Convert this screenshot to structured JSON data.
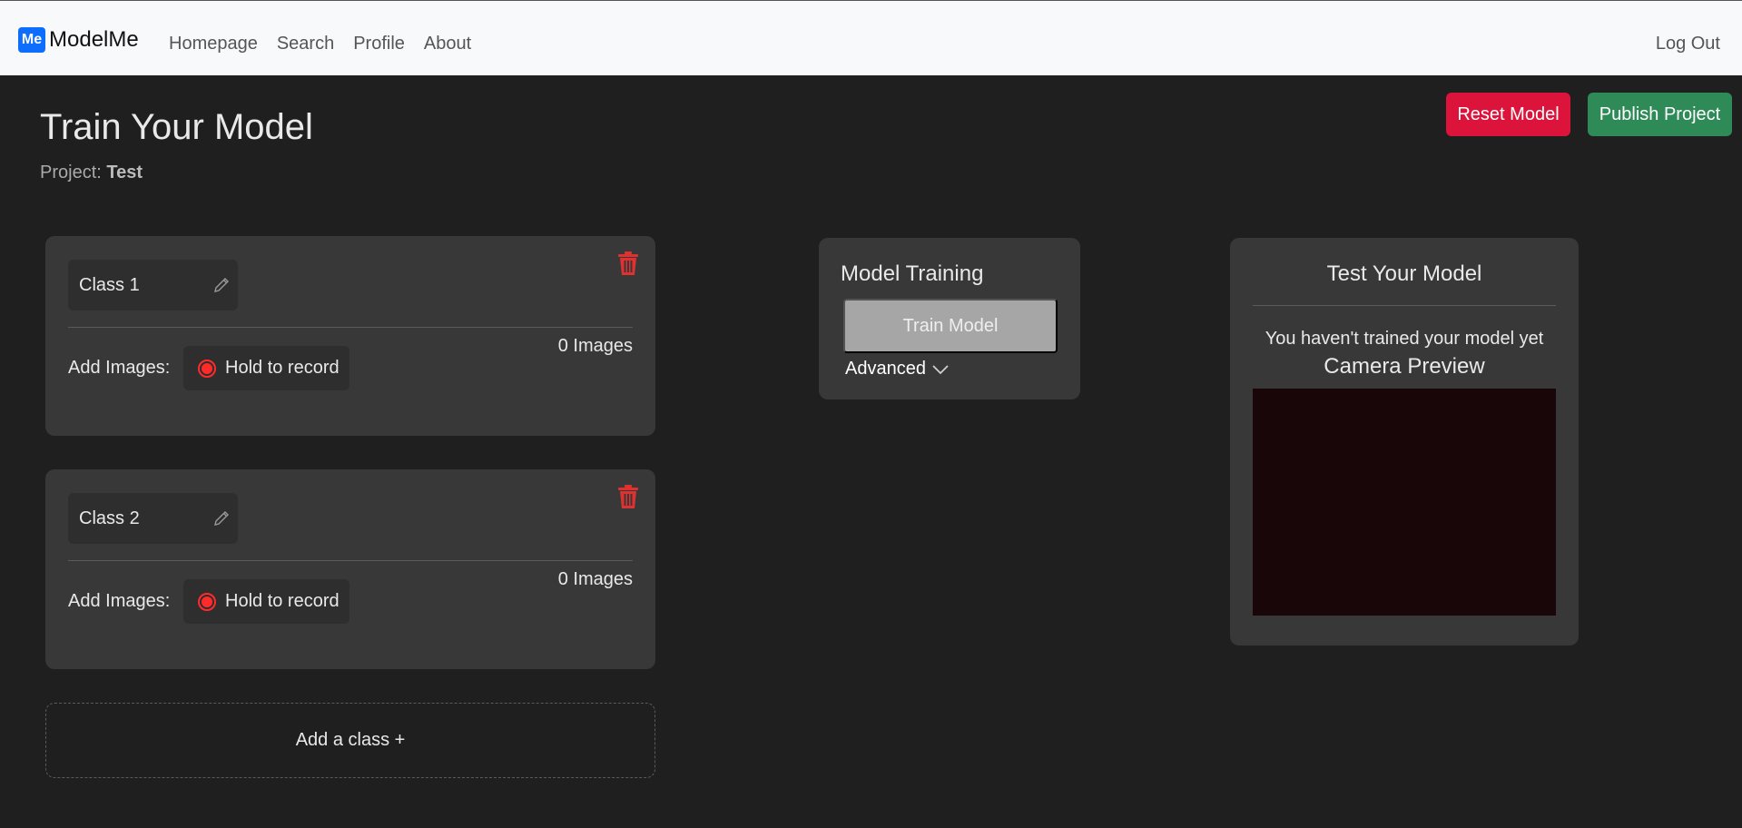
{
  "nav": {
    "brand_logo": "Me",
    "brand_name": "ModelMe",
    "links": [
      "Homepage",
      "Search",
      "Profile",
      "About"
    ],
    "logout": "Log Out"
  },
  "header": {
    "title": "Train Your Model",
    "project_label": "Project:",
    "project_name": "Test",
    "reset_label": "Reset Model",
    "publish_label": "Publish Project"
  },
  "classes": [
    {
      "name": "Class 1",
      "image_count": "0 Images",
      "add_images_label": "Add Images:",
      "record_label": "Hold to record"
    },
    {
      "name": "Class 2",
      "image_count": "0 Images",
      "add_images_label": "Add Images:",
      "record_label": "Hold to record"
    }
  ],
  "add_class_label": "Add a class +",
  "training": {
    "title": "Model Training",
    "train_label": "Train Model",
    "advanced_label": "Advanced"
  },
  "test": {
    "title": "Test Your Model",
    "message": "You haven't trained your model yet",
    "camera_title": "Camera Preview"
  },
  "colors": {
    "background": "#1f1f1f",
    "card": "#383838",
    "reset": "#dc143c",
    "publish": "#2e8b57",
    "brand": "#0d6efd",
    "delete": "#e03131"
  }
}
